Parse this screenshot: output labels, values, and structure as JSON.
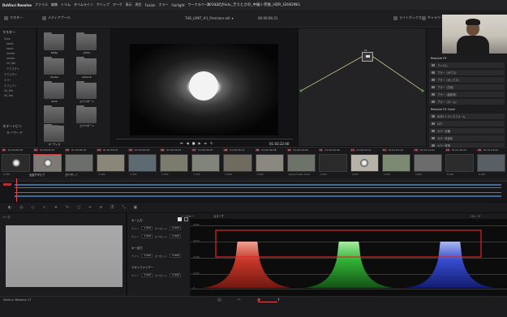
{
  "menubar": {
    "app": "DaVinci Resolve",
    "items": [
      "ファイル",
      "編集",
      "トリム",
      "タイムライン",
      "クリップ",
      "マーク",
      "表示",
      "再生",
      "Fusion",
      "カラー",
      "Fairlight",
      "ワークスペース",
      "ヘルプ"
    ],
    "window_title": "201117_Hulu_きうとさの_中編＋完後_HDR_GRADING"
  },
  "toolbar": {
    "media_pool": "マスター",
    "media_page": "メディアプール",
    "timeline_name": "THE_LIMIT_#1_Premiere.edl",
    "timecode": "00:00:06:21",
    "lightbox": "ライトボックス",
    "gallery": "ギャラリー"
  },
  "media_pool": {
    "header": "マスター",
    "tree": [
      "Scan",
      "stock",
      "stock",
      "render",
      "render",
      "00_flat",
      "テクスチャ",
      "テクスチャ",
      "エラー",
      "エフェクト",
      "00_flat",
      "00_flat"
    ],
    "smart_bins_header": "スマートビン",
    "smart_bins": [
      "キーワード"
    ],
    "folders": [
      {
        "label": "60fps"
      },
      {
        "label": "photo"
      },
      {
        "label": "render"
      },
      {
        "label": "artwork"
      },
      {
        "label": "stock"
      },
      {
        "label": "エクスポート"
      },
      {
        "label": "shadow"
      },
      {
        "label": "エクスポート"
      },
      {
        "label": "オーディオ"
      }
    ]
  },
  "viewer": {
    "timecode": "01:03:22:00",
    "clip_name": "THE_LIMIT_#1"
  },
  "node_editor": {
    "node_label": "01"
  },
  "right_panel": {
    "section1": "Resolve FX",
    "items1": [
      "フィルム",
      "ブラー（ガウス）",
      "ブラー（ボックス）",
      "ブラー（方向）",
      "ブラー（放射状）",
      "ブラー（ズーム）"
    ],
    "section2": "Resolve FX Color",
    "items2": [
      "ACES トランスフォーム",
      "CST",
      "カラー圧縮",
      "カラー安定化",
      "カラー変換",
      "カラーフィルター",
      "カラーストライプ"
    ]
  },
  "clips": [
    {
      "num": "01",
      "tc": "01:00:00:00",
      "caption": "H.265"
    },
    {
      "num": "02",
      "tc": "00:00:04:23",
      "caption": "H.265"
    },
    {
      "num": "03",
      "tc": "01:00:09:16",
      "caption": "H.265"
    },
    {
      "num": "04",
      "tc": "01:00:16:10",
      "caption": "H.265"
    },
    {
      "num": "05",
      "tc": "01:00:20:03",
      "caption": "H.265"
    },
    {
      "num": "06",
      "tc": "01:00:25:21",
      "caption": "H.265"
    },
    {
      "num": "07",
      "tc": "01:00:30:07",
      "caption": "H.265"
    },
    {
      "num": "08",
      "tc": "01:00:35:11",
      "caption": "H.265"
    },
    {
      "num": "09",
      "tc": "01:00:39:08",
      "caption": "H.265"
    },
    {
      "num": "10",
      "tc": "01:00:44:16",
      "caption": "Apple ProRes 4444"
    },
    {
      "num": "11",
      "tc": "01:00:49:00",
      "caption": "H.265"
    },
    {
      "num": "12",
      "tc": "01:00:55:11",
      "caption": "H.265"
    },
    {
      "num": "13",
      "tc": "01:01:03:19",
      "caption": "H.265"
    },
    {
      "num": "14",
      "tc": "01:01:11:01",
      "caption": "H.265"
    },
    {
      "num": "15",
      "tc": "01:01:18:23",
      "caption": "H.265"
    },
    {
      "num": "16",
      "tc": "01:01:22:09",
      "caption": "H.265"
    }
  ],
  "timeline_tabs": {
    "clips": "全部クリップ",
    "tracks": "全トラック"
  },
  "bottom_panel": {
    "label_left": "バーズ",
    "tab_node": "ノードキー",
    "tab_scope": "スコープ",
    "tab_right": "パレード",
    "key_input": "キー入力",
    "key_output": "キー出力",
    "qualifier": "クオリファイアー",
    "gain": "ゲイン",
    "offset": "オフセット",
    "gain_value": "1.000",
    "offset_value": "0.000",
    "scope_labels": [
      "4095",
      "3072",
      "2048",
      "1024",
      "0"
    ]
  },
  "statusbar": {
    "app": "DaVinci Resolve 17"
  }
}
